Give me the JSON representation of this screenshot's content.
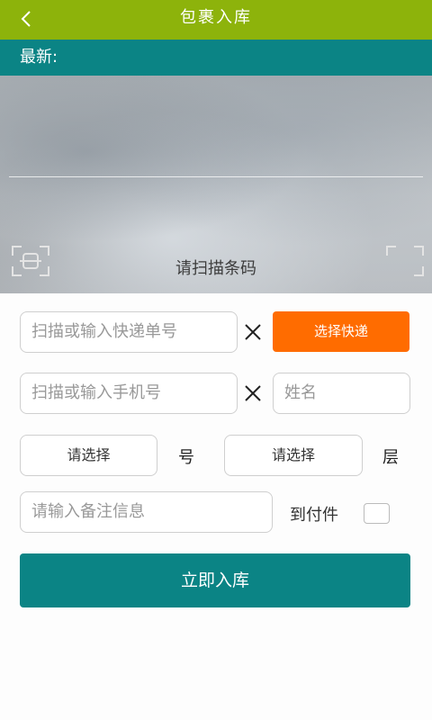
{
  "header": {
    "back_icon": "chevron-left-icon",
    "title": "包裹入库"
  },
  "latest": {
    "label": "最新:"
  },
  "scanner": {
    "hint": "请扫描条码",
    "left_icon": "scan-frame-icon",
    "right_icon": "scan-frame-icon"
  },
  "form": {
    "tracking": {
      "placeholder": "扫描或输入快递单号",
      "clear_icon": "close-icon"
    },
    "courier_button": "选择快递",
    "phone": {
      "placeholder": "扫描或输入手机号",
      "clear_icon": "close-icon"
    },
    "name": {
      "placeholder": "姓名"
    },
    "shelf_number": {
      "value": "请选择",
      "unit": "号"
    },
    "shelf_layer": {
      "value": "请选择",
      "unit": "层"
    },
    "remark": {
      "placeholder": "请输入备注信息"
    },
    "cod": {
      "label": "到付件",
      "checked": false
    },
    "submit_label": "立即入库"
  },
  "colors": {
    "header_bg": "#8db30b",
    "teal": "#0b8485",
    "orange": "#ff6c00"
  }
}
